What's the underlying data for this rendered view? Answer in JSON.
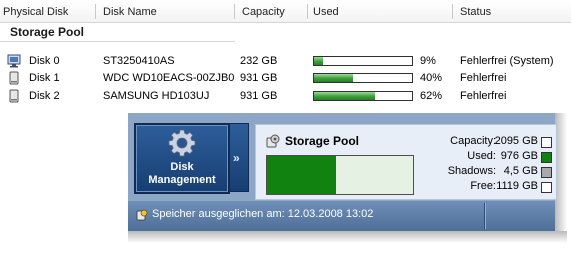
{
  "columns": {
    "physical_disk": "Physical Disk",
    "disk_name": "Disk Name",
    "capacity": "Capacity",
    "used": "Used",
    "status": "Status"
  },
  "group_label": "Storage Pool",
  "disks": [
    {
      "name": "Disk 0",
      "model": "ST3250410AS",
      "capacity": "232 GB",
      "used_fraction": 0.09,
      "used_pct": "9%",
      "status": "Fehlerfrei (System)",
      "icon": "monitor-icon"
    },
    {
      "name": "Disk 1",
      "model": "WDC WD10EACS-00ZJB0",
      "capacity": "931 GB",
      "used_fraction": 0.4,
      "used_pct": "40%",
      "status": "Fehlerfrei",
      "icon": "disk-icon"
    },
    {
      "name": "Disk 2",
      "model": "SAMSUNG HD103UJ",
      "capacity": "931 GB",
      "used_fraction": 0.62,
      "used_pct": "62%",
      "status": "Fehlerfrei",
      "icon": "disk-icon"
    }
  ],
  "tile": {
    "label_line1": "Disk",
    "label_line2": "Management",
    "icon": "gear-icon",
    "expand": "»"
  },
  "pool_summary": {
    "title": "Storage Pool",
    "used_fraction": 0.47,
    "stats": [
      {
        "label": "Capacity:",
        "value": "2095 GB",
        "swatch": "#ffffff"
      },
      {
        "label": "Used:",
        "value": "976 GB",
        "swatch": "#11820f"
      },
      {
        "label": "Shadows:",
        "value": "4,5 GB",
        "swatch": "#a9a9a9"
      },
      {
        "label": "Free:",
        "value": "1119 GB",
        "swatch": "#ffffff"
      }
    ]
  },
  "status_message": "Speicher ausgeglichen am: 12.03.2008 13:02",
  "colors": {
    "used_green": "#11820f",
    "taskbar_blue": "#4f6f9a",
    "tile_blue": "#1f4a82"
  }
}
